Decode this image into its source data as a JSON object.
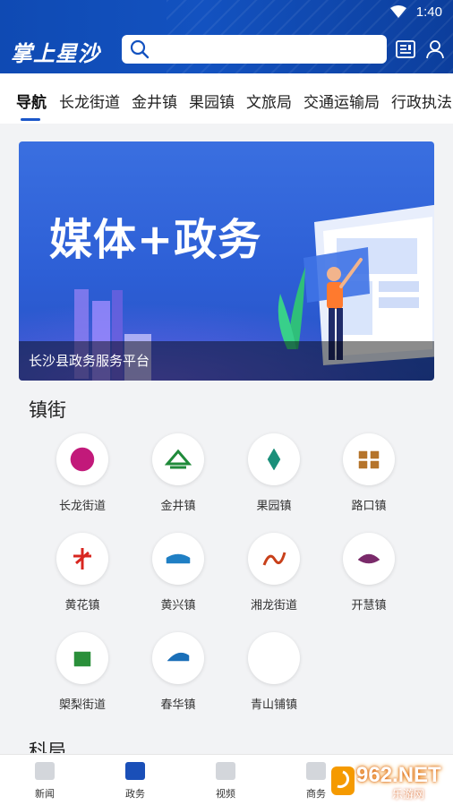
{
  "status": {
    "time": "1:40"
  },
  "header": {
    "logo": "掌上星沙",
    "search_placeholder": ""
  },
  "tabs": [
    "导航",
    "长龙街道",
    "金井镇",
    "果园镇",
    "文旅局",
    "交通运输局",
    "行政执法"
  ],
  "banner": {
    "title": "媒体+政务",
    "caption": "长沙县政务服务平台"
  },
  "section": {
    "title": "镇街",
    "items": [
      {
        "label": "长龙街道",
        "icon": "changlong-logo-icon",
        "color": "#c2197a"
      },
      {
        "label": "金井镇",
        "icon": "jinjing-logo-icon",
        "color": "#1f8a3a"
      },
      {
        "label": "果园镇",
        "icon": "guoyuan-logo-icon",
        "color": "#1a8f7a"
      },
      {
        "label": "路口镇",
        "icon": "lukou-logo-icon",
        "color": "#b5742b"
      },
      {
        "label": "黄花镇",
        "icon": "huanghua-logo-icon",
        "color": "#d8261f"
      },
      {
        "label": "黄兴镇",
        "icon": "huangxing-logo-icon",
        "color": "#1f7fc4"
      },
      {
        "label": "湘龙街道",
        "icon": "xianglong-logo-icon",
        "color": "#c8401a"
      },
      {
        "label": "开慧镇",
        "icon": "kaihui-logo-icon",
        "color": "#7a2a6a"
      },
      {
        "label": "㮾梨街道",
        "icon": "langli-logo-icon",
        "color": "#2a8f3a"
      },
      {
        "label": "春华镇",
        "icon": "chunhua-logo-icon",
        "color": "#1a6fb8"
      },
      {
        "label": "青山铺镇",
        "icon": "",
        "color": "#ffffff"
      }
    ],
    "next_title": "科局"
  },
  "bottom_nav": [
    {
      "label": "新闻",
      "icon": "news-icon"
    },
    {
      "label": "政务",
      "icon": "gov-icon",
      "active": true
    },
    {
      "label": "视频",
      "icon": "video-icon"
    },
    {
      "label": "商务",
      "icon": "business-icon"
    }
  ],
  "watermark": {
    "brand": "962.NET",
    "sub": "乐游网"
  },
  "colors": {
    "header_blue": "#1352c0",
    "accent": "#1a56c9"
  }
}
